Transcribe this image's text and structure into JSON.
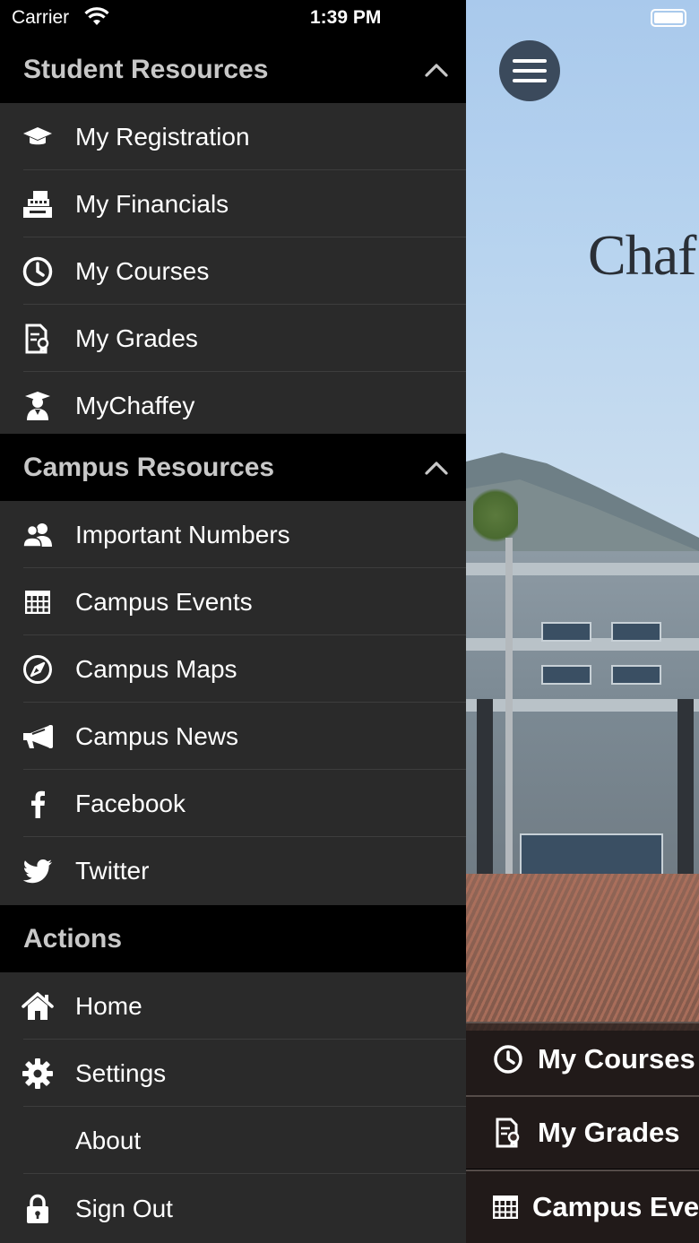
{
  "status_bar": {
    "carrier": "Carrier",
    "time": "1:39 PM"
  },
  "background": {
    "logo_text": "Chaf",
    "quick_links": [
      {
        "label": "My Courses",
        "icon": "clock-icon"
      },
      {
        "label": "My Grades",
        "icon": "grades-icon"
      },
      {
        "label": "Campus Eve",
        "icon": "calendar-icon"
      }
    ]
  },
  "drawer": {
    "student_resources": {
      "title": "Student Resources",
      "items": [
        {
          "label": "My Registration",
          "icon": "graduation-cap-icon"
        },
        {
          "label": "My Financials",
          "icon": "cash-register-icon"
        },
        {
          "label": "My Courses",
          "icon": "clock-icon"
        },
        {
          "label": "My Grades",
          "icon": "grades-icon"
        },
        {
          "label": "MyChaffey",
          "icon": "graduate-person-icon"
        }
      ]
    },
    "campus_resources": {
      "title": "Campus Resources",
      "items": [
        {
          "label": "Important Numbers",
          "icon": "people-icon"
        },
        {
          "label": "Campus Events",
          "icon": "calendar-icon"
        },
        {
          "label": "Campus Maps",
          "icon": "compass-icon"
        },
        {
          "label": "Campus News",
          "icon": "megaphone-icon"
        },
        {
          "label": "Facebook",
          "icon": "facebook-icon"
        },
        {
          "label": "Twitter",
          "icon": "twitter-icon"
        }
      ]
    },
    "actions": {
      "title": "Actions",
      "items": [
        {
          "label": "Home",
          "icon": "home-icon"
        },
        {
          "label": "Settings",
          "icon": "gear-icon"
        },
        {
          "label": "About",
          "icon": ""
        },
        {
          "label": "Sign Out",
          "icon": "lock-icon"
        }
      ]
    }
  },
  "colors": {
    "drawer_bg": "#2a2a2a",
    "header_bg": "#000000",
    "header_text": "#c8c8c8",
    "item_text": "#ffffff",
    "menu_button": "#3b4a5c"
  }
}
